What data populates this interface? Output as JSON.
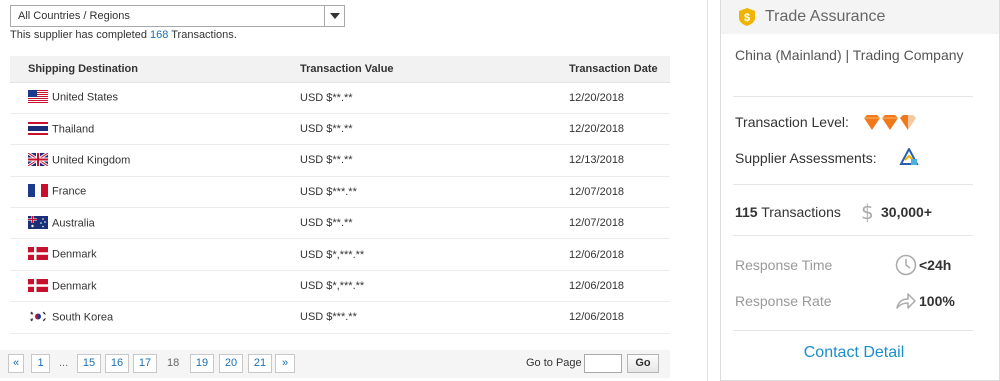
{
  "filter": {
    "selected": "All Countries / Regions"
  },
  "summary": {
    "prefix": "This supplier has completed ",
    "count": "168",
    "suffix": " Transactions."
  },
  "table": {
    "headers": [
      "Shipping Destination",
      "Transaction Value",
      "Transaction Date"
    ],
    "rows": [
      {
        "country": "United States",
        "flag": "us-flag-icon",
        "value": "USD $**.**",
        "date": "12/20/2018"
      },
      {
        "country": "Thailand",
        "flag": "th-flag-icon",
        "value": "USD $**.**",
        "date": "12/20/2018"
      },
      {
        "country": "United Kingdom",
        "flag": "gb-flag-icon",
        "value": "USD $**.**",
        "date": "12/13/2018"
      },
      {
        "country": "France",
        "flag": "fr-flag-icon",
        "value": "USD $***.**",
        "date": "12/07/2018"
      },
      {
        "country": "Australia",
        "flag": "au-flag-icon",
        "value": "USD $**.**",
        "date": "12/07/2018"
      },
      {
        "country": "Denmark",
        "flag": "dk-flag-icon",
        "value": "USD $*,***.**",
        "date": "12/06/2018"
      },
      {
        "country": "Denmark",
        "flag": "dk-flag-icon",
        "value": "USD $*,***.**",
        "date": "12/06/2018"
      },
      {
        "country": "South Korea",
        "flag": "kr-flag-icon",
        "value": "USD $***.**",
        "date": "12/06/2018"
      }
    ]
  },
  "pagination": {
    "prev": "«",
    "first": "1",
    "ellipsis": "...",
    "pages": [
      "15",
      "16",
      "17"
    ],
    "current": "18",
    "pages_after": [
      "19",
      "20",
      "21"
    ],
    "next": "»",
    "goto_label": "Go to Page",
    "goto_value": "",
    "go_button": "Go"
  },
  "trade_assurance": {
    "title": "Trade Assurance",
    "company": "China (Mainland)  |  Trading Company",
    "transaction_level_label": "Transaction Level:",
    "transaction_level_gems": 2.5,
    "supplier_assessments_label": "Supplier Assessments:",
    "transactions_count": "115",
    "transactions_label": " Transactions",
    "transactions_amount": "30,000+",
    "response_time_label": "Response Time",
    "response_time_value": "<24h",
    "response_rate_label": "Response Rate",
    "response_rate_value": "100%",
    "contact_label": "Contact Detail"
  },
  "colors": {
    "link": "#1a6fb5",
    "contact": "#1a8fc9",
    "gem": "#f07a1a"
  }
}
